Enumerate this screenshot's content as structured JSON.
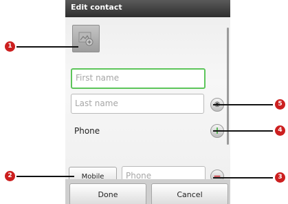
{
  "dialog": {
    "title": "Edit contact",
    "first_name_placeholder": "First name",
    "last_name_placeholder": "Last name",
    "section_label": "Phone",
    "phone_type": "Mobile",
    "phone_placeholder": "Phone",
    "done_label": "Done",
    "cancel_label": "Cancel"
  },
  "callouts": [
    "1",
    "2",
    "3",
    "4",
    "5"
  ],
  "colors": {
    "focus_green": "#5cc55a",
    "badge_red": "#cc1f1f",
    "add_green": "#3aa936",
    "remove_red": "#d0303a"
  },
  "icons": {
    "photo": "contact-photo-icon",
    "expand": "expand-icon",
    "add": "add-icon",
    "remove": "remove-icon"
  }
}
